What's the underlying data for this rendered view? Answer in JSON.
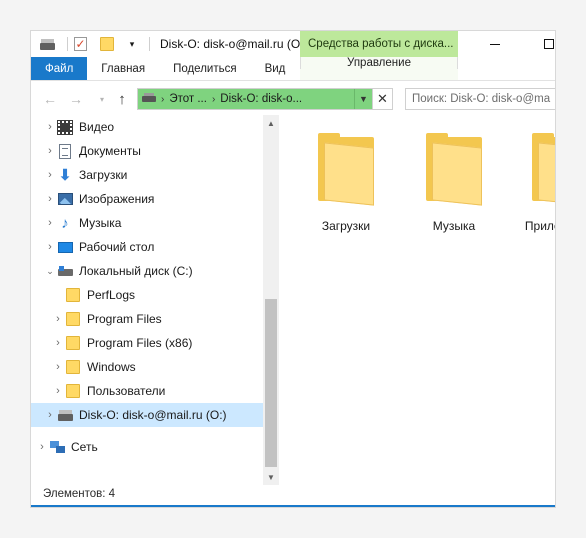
{
  "window": {
    "title": "Disk-O: disk-o@mail.ru (O:)",
    "tools_tab": "Средства работы с диска...",
    "accent_color": "#1979ca",
    "tools_color": "#bde89b"
  },
  "ribbon": {
    "tabs": [
      "Файл",
      "Главная",
      "Поделиться",
      "Вид"
    ],
    "manage_tab": "Управление"
  },
  "address": {
    "segment_1": "Этот ...",
    "segment_2": "Disk-O: disk-o...",
    "search_placeholder": "Поиск: Disk-O: disk-o@ma"
  },
  "nav": {
    "items": [
      {
        "label": "Видео",
        "icon": "video-icon",
        "expand": "collapsed",
        "level": 1
      },
      {
        "label": "Документы",
        "icon": "documents-icon",
        "expand": "collapsed",
        "level": 1
      },
      {
        "label": "Загрузки",
        "icon": "downloads-icon",
        "expand": "collapsed",
        "level": 1
      },
      {
        "label": "Изображения",
        "icon": "pictures-icon",
        "expand": "collapsed",
        "level": 1
      },
      {
        "label": "Музыка",
        "icon": "music-icon",
        "expand": "collapsed",
        "level": 1
      },
      {
        "label": "Рабочий стол",
        "icon": "desktop-icon",
        "expand": "collapsed",
        "level": 1
      },
      {
        "label": "Локальный диск (C:)",
        "icon": "local-disk-icon",
        "expand": "expanded",
        "level": 1
      },
      {
        "label": "PerfLogs",
        "icon": "folder-icon",
        "expand": "none",
        "level": 2
      },
      {
        "label": "Program Files",
        "icon": "folder-icon",
        "expand": "collapsed",
        "level": 2
      },
      {
        "label": "Program Files (x86)",
        "icon": "folder-icon",
        "expand": "collapsed",
        "level": 2
      },
      {
        "label": "Windows",
        "icon": "folder-icon",
        "expand": "collapsed",
        "level": 2
      },
      {
        "label": "Пользователи",
        "icon": "folder-icon",
        "expand": "collapsed",
        "level": 2
      },
      {
        "label": "Disk-O: disk-o@mail.ru (O:)",
        "icon": "drive-icon",
        "expand": "collapsed",
        "level": 1,
        "selected": true
      },
      {
        "label": "Сеть",
        "icon": "network-icon",
        "expand": "collapsed",
        "level": 0
      }
    ]
  },
  "content": {
    "folders": [
      "Загрузки",
      "Музыка",
      "Приложения"
    ]
  },
  "status": {
    "text": "Элементов: 4"
  }
}
